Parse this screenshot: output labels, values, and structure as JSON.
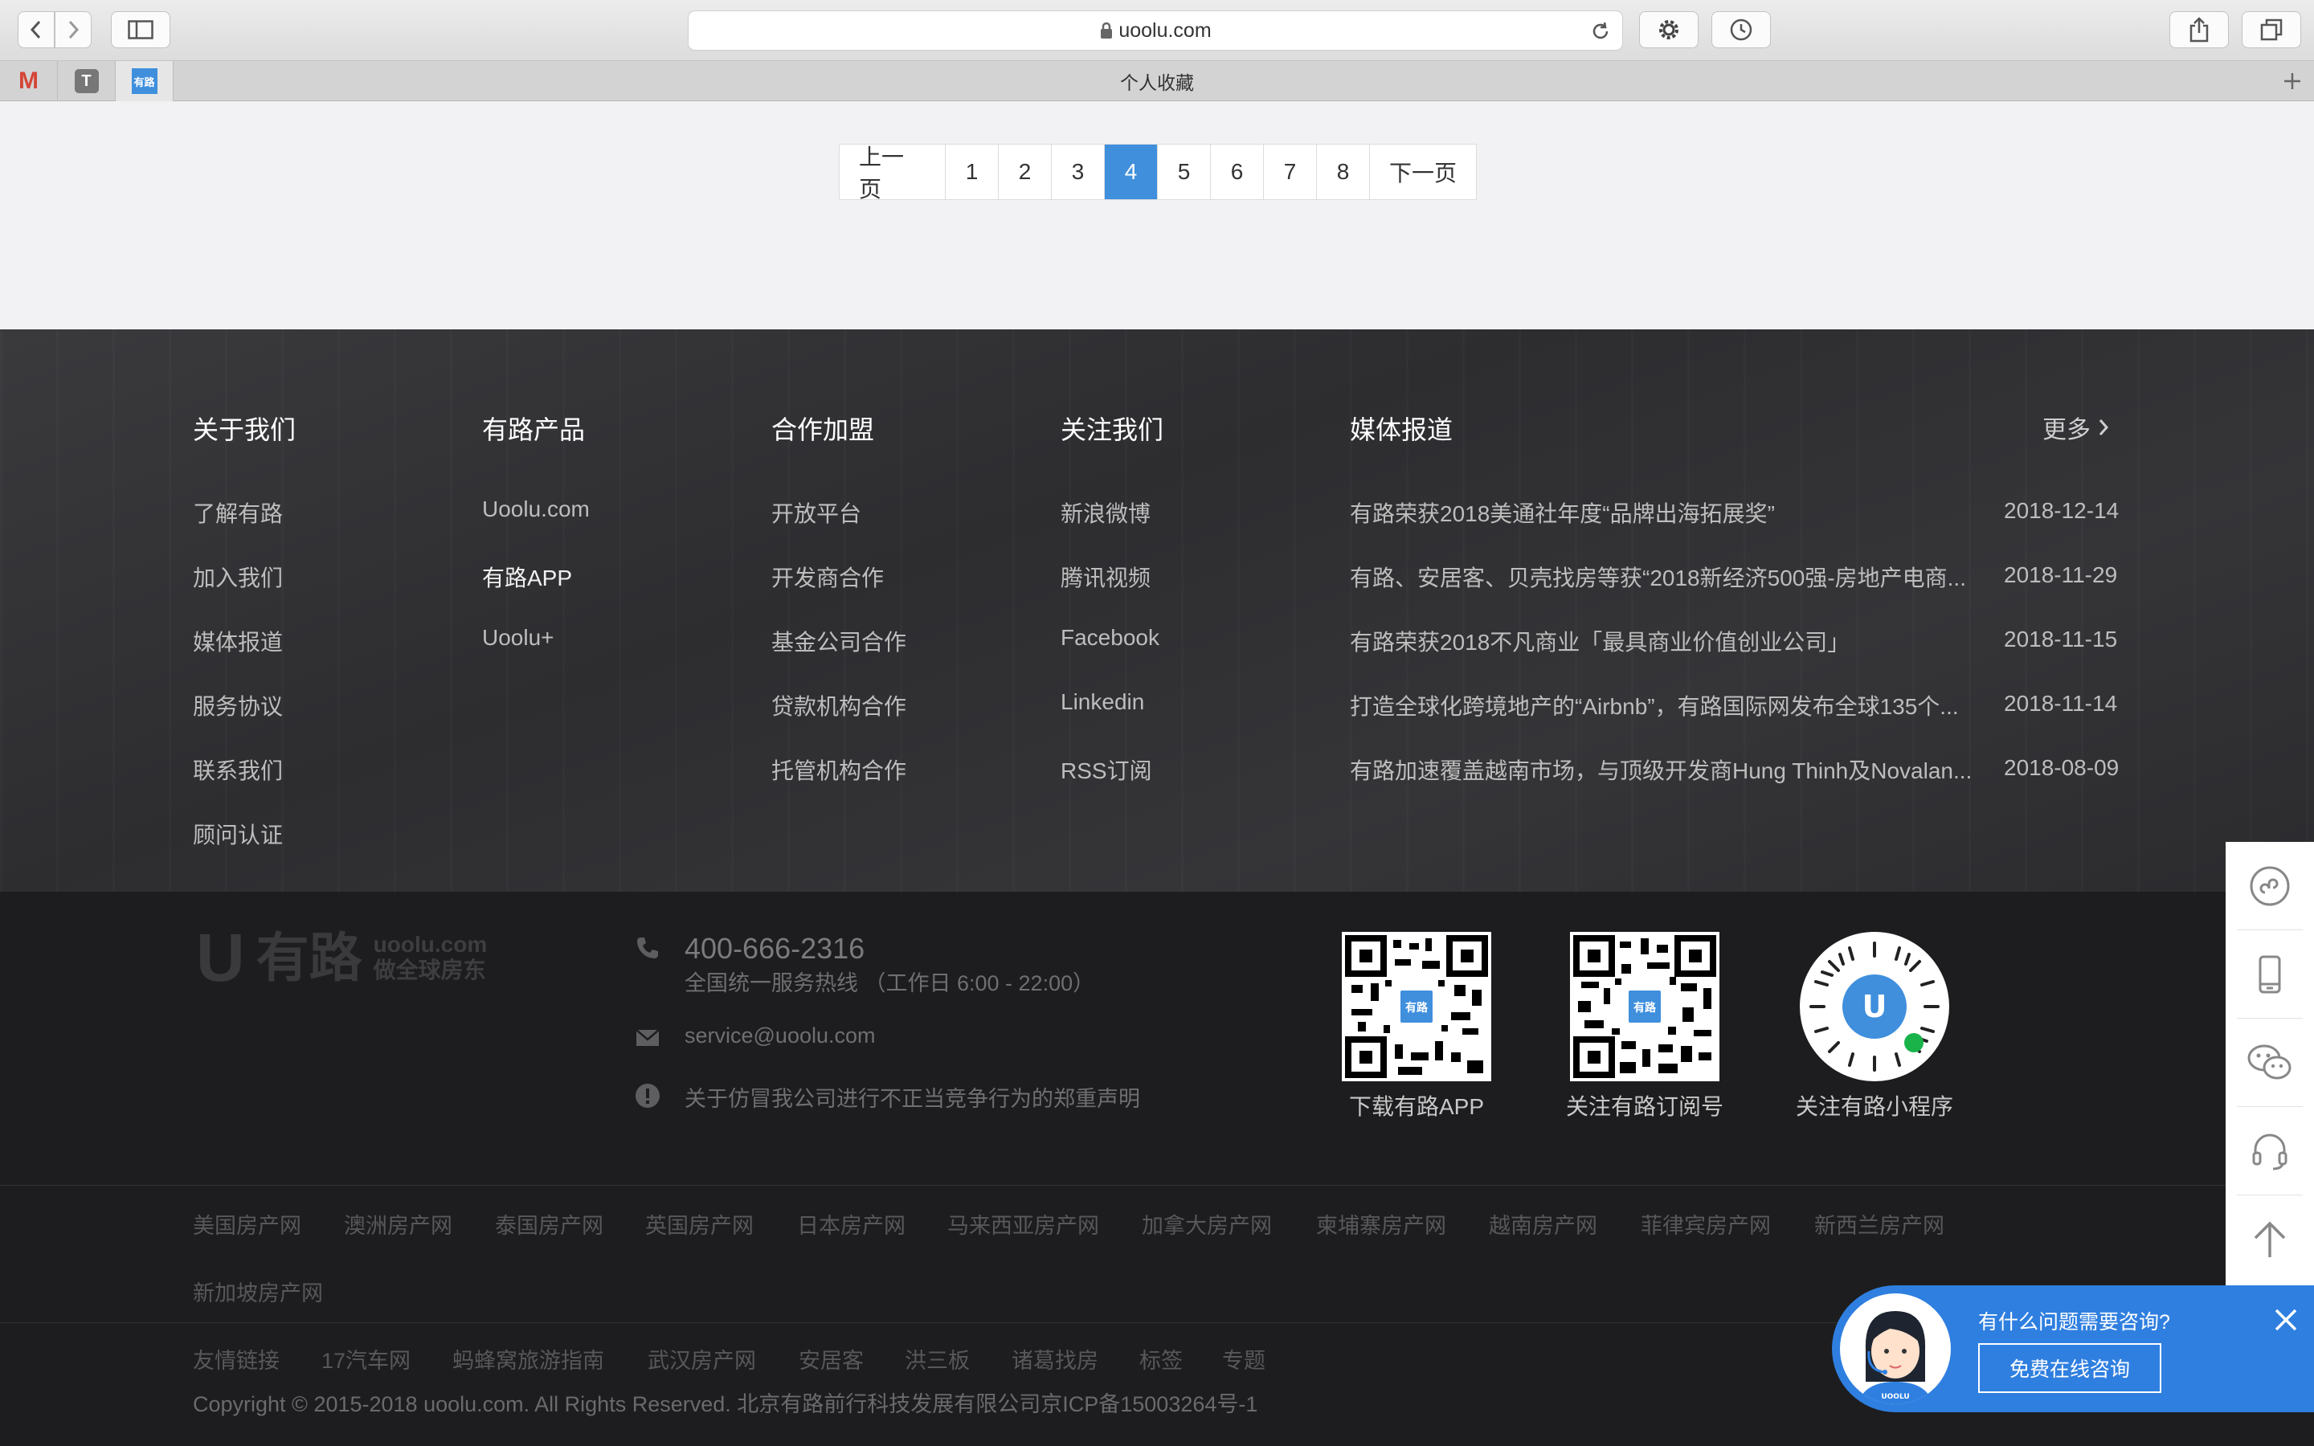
{
  "browser": {
    "url": "uoolu.com",
    "tab_title": "个人收藏",
    "favorites": [
      "M",
      "T",
      "有路"
    ]
  },
  "pagination": {
    "prev": "上一页",
    "pages": [
      "1",
      "2",
      "3",
      "4",
      "5",
      "6",
      "7",
      "8"
    ],
    "current": "4",
    "next": "下一页"
  },
  "footer": {
    "about": {
      "title": "关于我们",
      "links": [
        "了解有路",
        "加入我们",
        "媒体报道",
        "服务协议",
        "联系我们",
        "顾问认证"
      ]
    },
    "products": {
      "title": "有路产品",
      "links": [
        "Uoolu.com",
        "有路APP",
        "Uoolu+"
      ]
    },
    "partners": {
      "title": "合作加盟",
      "links": [
        "开放平台",
        "开发商合作",
        "基金公司合作",
        "贷款机构合作",
        "托管机构合作"
      ]
    },
    "follow": {
      "title": "关注我们",
      "links": [
        "新浪微博",
        "腾讯视频",
        "Facebook",
        "Linkedin",
        "RSS订阅"
      ]
    },
    "media": {
      "title": "媒体报道",
      "more": "更多",
      "items": [
        {
          "title": "有路荣获2018美通社年度“品牌出海拓展奖”",
          "date": "2018-12-14"
        },
        {
          "title": "有路、安居客、贝壳找房等获“2018新经济500强-房地产电商...",
          "date": "2018-11-29"
        },
        {
          "title": "有路荣获2018不凡商业「最具商业价值创业公司」",
          "date": "2018-11-15"
        },
        {
          "title": "打造全球化跨境地产的“Airbnb”，有路国际网发布全球135个...",
          "date": "2018-11-14"
        },
        {
          "title": "有路加速覆盖越南市场，与顶级开发商Hung Thinh及Novalan...",
          "date": "2018-08-09"
        }
      ]
    }
  },
  "brand": {
    "logo_mark": "U",
    "logo_cn": "有路",
    "domain": "uoolu.com",
    "slogan": "做全球房东"
  },
  "contact": {
    "phone": "400-666-2316",
    "phone_note": "全国统一服务热线 （工作日 6:00 - 22:00）",
    "email": "service@uoolu.com",
    "notice": "关于仿冒我公司进行不正当竞争行为的郑重声明"
  },
  "qrcodes": [
    {
      "label": "下载有路APP",
      "icon": "qr-app"
    },
    {
      "label": "关注有路订阅号",
      "icon": "qr-wechat"
    },
    {
      "label": "关注有路小程序",
      "icon": "qr-miniprogram"
    }
  ],
  "country_sites": [
    "美国房产网",
    "澳洲房产网",
    "泰国房产网",
    "英国房产网",
    "日本房产网",
    "马来西亚房产网",
    "加拿大房产网",
    "柬埔寨房产网",
    "越南房产网",
    "菲律宾房产网",
    "新西兰房产网",
    "新加坡房产网"
  ],
  "friend_links": {
    "label": "友情链接",
    "items": [
      "17汽车网",
      "蚂蜂窝旅游指南",
      "武汉房产网",
      "安居客",
      "洪三板",
      "诸葛找房",
      "标签",
      "专题"
    ]
  },
  "copyright": "Copyright © 2015-2018 uoolu.com. All Rights Reserved. 北京有路前行科技发展有限公司京ICP备15003264号-1",
  "sidebar": [
    "mini-program-icon",
    "mobile-icon",
    "wechat-icon",
    "headset-icon",
    "back-to-top-icon"
  ],
  "chat": {
    "question": "有什么问题需要咨询?",
    "button": "免费在线咨询",
    "avatar_badge": "UOOLU",
    "accent": "#2f7fe0"
  },
  "colors": {
    "pager_active": "#3f8fdd",
    "footer_bg": "#1d1d1f"
  }
}
